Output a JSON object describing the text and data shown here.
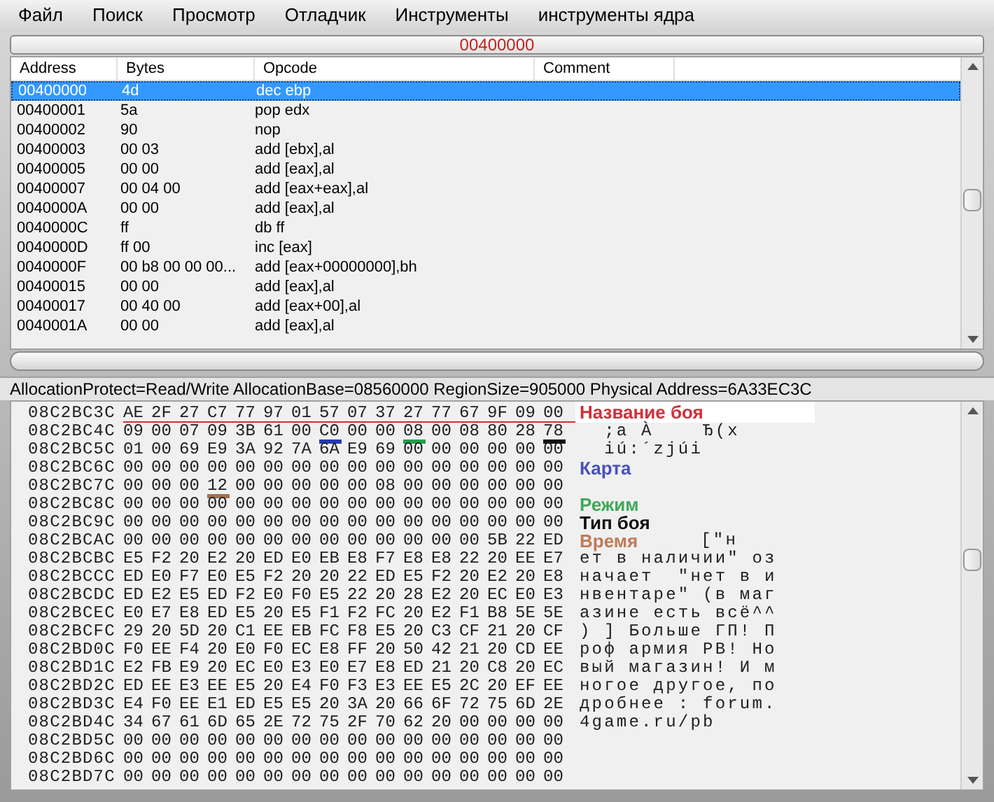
{
  "menu": [
    "Файл",
    "Поиск",
    "Просмотр",
    "Отладчик",
    "Инструменты",
    "инструменты ядра"
  ],
  "address_bar": {
    "value": "00400000"
  },
  "disassembly": {
    "columns": [
      "Address",
      "Bytes",
      "Opcode",
      "Comment"
    ],
    "rows": [
      {
        "address": "00400000",
        "bytes": "4d",
        "opcode": "dec ebp",
        "selected": true
      },
      {
        "address": "00400001",
        "bytes": "5a",
        "opcode": "pop edx",
        "selected": false
      },
      {
        "address": "00400002",
        "bytes": "90",
        "opcode": "nop",
        "selected": false
      },
      {
        "address": "00400003",
        "bytes": "00 03",
        "opcode": "add [ebx],al",
        "selected": false
      },
      {
        "address": "00400005",
        "bytes": "00 00",
        "opcode": "add [eax],al",
        "selected": false
      },
      {
        "address": "00400007",
        "bytes": "00 04 00",
        "opcode": "add [eax+eax],al",
        "selected": false
      },
      {
        "address": "0040000A",
        "bytes": "00 00",
        "opcode": "add [eax],al",
        "selected": false
      },
      {
        "address": "0040000C",
        "bytes": "ff",
        "opcode": "db ff",
        "selected": false
      },
      {
        "address": "0040000D",
        "bytes": "ff 00",
        "opcode": "inc [eax]",
        "selected": false
      },
      {
        "address": "0040000F",
        "bytes": "00 b8 00 00 00...",
        "opcode": "add [eax+00000000],bh",
        "selected": false
      },
      {
        "address": "00400015",
        "bytes": "00 00",
        "opcode": "add [eax],al",
        "selected": false
      },
      {
        "address": "00400017",
        "bytes": "00 40 00",
        "opcode": "add [eax+00],al",
        "selected": false
      },
      {
        "address": "0040001A",
        "bytes": "00 00",
        "opcode": "add [eax],al",
        "selected": false
      }
    ]
  },
  "status": "AllocationProtect=Read/Write  AllocationBase=08560000 RegionSize=905000 Physical Address=6A33EC3C",
  "hex_view": {
    "rows": [
      {
        "address": "08C2BC3C",
        "color": "#d03030",
        "bytes": [
          "AE",
          "2F",
          "27",
          "C7",
          "77",
          "97",
          "01",
          "57",
          "07",
          "37",
          "27",
          "77",
          "67",
          "9F",
          "09",
          "00"
        ],
        "note": {
          "text": "Название боя",
          "color": "#d0303a",
          "boxed": true
        }
      },
      {
        "address": "08C2BC4C",
        "bytes": [
          "09",
          "00",
          "07",
          "09",
          "3B",
          "61",
          "00",
          {
            "text": "C0",
            "color": "#2838b8"
          },
          "00",
          "00",
          {
            "text": "08",
            "color": "#20a050"
          },
          "00",
          "08",
          "80",
          "28",
          {
            "text": "78",
            "color": "#101010"
          }
        ],
        "ascii": "  ;a À    Ђ(x"
      },
      {
        "address": "08C2BC5C",
        "bytes": [
          "01",
          "00",
          "69",
          "E9",
          "3A",
          "92",
          "7A",
          "6A",
          "E9",
          "69",
          "00",
          "00",
          "00",
          "00",
          "00",
          "00"
        ],
        "ascii": "  iú:´zjúi"
      },
      {
        "address": "08C2BC6C",
        "bytes": [
          "00",
          "00",
          "00",
          "00",
          "00",
          "00",
          "00",
          "00",
          "00",
          "00",
          "00",
          "00",
          "00",
          "00",
          "00",
          "00"
        ],
        "note": {
          "text": "Карта",
          "color": "#4a52b4",
          "boxed": false
        }
      },
      {
        "address": "08C2BC7C",
        "bytes": [
          "00",
          "00",
          "00",
          {
            "text": "12",
            "color": "#a07050"
          },
          "00",
          "00",
          "00",
          "00",
          "00",
          "08",
          "00",
          "00",
          "00",
          "00",
          "00",
          "00"
        ]
      },
      {
        "address": "08C2BC8C",
        "bytes": [
          "00",
          "00",
          "00",
          "00",
          "00",
          "00",
          "00",
          "00",
          "00",
          "00",
          "00",
          "00",
          "00",
          "00",
          "00",
          "00"
        ],
        "note": {
          "text": "Режим",
          "color": "#40a858",
          "boxed": false
        }
      },
      {
        "address": "08C2BC9C",
        "bytes": [
          "00",
          "00",
          "00",
          "00",
          "00",
          "00",
          "00",
          "00",
          "00",
          "00",
          "00",
          "00",
          "00",
          "00",
          "00",
          "00"
        ],
        "note": {
          "text": "Тип боя",
          "color": "#101010",
          "boxed": false
        }
      },
      {
        "address": "08C2BCAC",
        "bytes": [
          "00",
          "00",
          "00",
          "00",
          "00",
          "00",
          "00",
          "00",
          "00",
          "00",
          "00",
          "00",
          "00",
          "5B",
          "22",
          "ED"
        ],
        "note": {
          "text": "Время",
          "color": "#c07a58",
          "boxed": false
        },
        "ascii": "[\"н"
      },
      {
        "address": "08C2BCBC",
        "bytes": [
          "E5",
          "F2",
          "20",
          "E2",
          "20",
          "ED",
          "E0",
          "EB",
          "E8",
          "F7",
          "E8",
          "E8",
          "22",
          "20",
          "EE",
          "E7"
        ],
        "ascii": "ет в наличии\" оз"
      },
      {
        "address": "08C2BCCC",
        "bytes": [
          "ED",
          "E0",
          "F7",
          "E0",
          "E5",
          "F2",
          "20",
          "20",
          "22",
          "ED",
          "E5",
          "F2",
          "20",
          "E2",
          "20",
          "E8"
        ],
        "ascii": "начает  \"нет в и"
      },
      {
        "address": "08C2BCDC",
        "bytes": [
          "ED",
          "E2",
          "E5",
          "ED",
          "F2",
          "E0",
          "F0",
          "E5",
          "22",
          "20",
          "28",
          "E2",
          "20",
          "EC",
          "E0",
          "E3"
        ],
        "ascii": "нвентаре\" (в маг"
      },
      {
        "address": "08C2BCEC",
        "bytes": [
          "E0",
          "E7",
          "E8",
          "ED",
          "E5",
          "20",
          "E5",
          "F1",
          "F2",
          "FC",
          "20",
          "E2",
          "F1",
          "B8",
          "5E",
          "5E"
        ],
        "ascii": "азине есть всё^^"
      },
      {
        "address": "08C2BCFC",
        "bytes": [
          "29",
          "20",
          "5D",
          "20",
          "C1",
          "EE",
          "EB",
          "FC",
          "F8",
          "E5",
          "20",
          "C3",
          "CF",
          "21",
          "20",
          "CF"
        ],
        "ascii": ") ] Больше ГП! П"
      },
      {
        "address": "08C2BD0C",
        "bytes": [
          "F0",
          "EE",
          "F4",
          "20",
          "E0",
          "F0",
          "EC",
          "E8",
          "FF",
          "20",
          "50",
          "42",
          "21",
          "20",
          "CD",
          "EE"
        ],
        "ascii": "роф армия PB! Но"
      },
      {
        "address": "08C2BD1C",
        "bytes": [
          "E2",
          "FB",
          "E9",
          "20",
          "EC",
          "E0",
          "E3",
          "E0",
          "E7",
          "E8",
          "ED",
          "21",
          "20",
          "C8",
          "20",
          "EC"
        ],
        "ascii": "вый магазин! И м"
      },
      {
        "address": "08C2BD2C",
        "bytes": [
          "ED",
          "EE",
          "E3",
          "EE",
          "E5",
          "20",
          "E4",
          "F0",
          "F3",
          "E3",
          "EE",
          "E5",
          "2C",
          "20",
          "EF",
          "EE"
        ],
        "ascii": "ногое другое, по"
      },
      {
        "address": "08C2BD3C",
        "bytes": [
          "E4",
          "F0",
          "EE",
          "E1",
          "ED",
          "E5",
          "E5",
          "20",
          "3A",
          "20",
          "66",
          "6F",
          "72",
          "75",
          "6D",
          "2E"
        ],
        "ascii": "дробнее : forum."
      },
      {
        "address": "08C2BD4C",
        "bytes": [
          "34",
          "67",
          "61",
          "6D",
          "65",
          "2E",
          "72",
          "75",
          "2F",
          "70",
          "62",
          "20",
          "00",
          "00",
          "00",
          "00"
        ],
        "ascii": "4game.ru/pb"
      },
      {
        "address": "08C2BD5C",
        "bytes": [
          "00",
          "00",
          "00",
          "00",
          "00",
          "00",
          "00",
          "00",
          "00",
          "00",
          "00",
          "00",
          "00",
          "00",
          "00",
          "00"
        ]
      },
      {
        "address": "08C2BD6C",
        "bytes": [
          "00",
          "00",
          "00",
          "00",
          "00",
          "00",
          "00",
          "00",
          "00",
          "00",
          "00",
          "00",
          "00",
          "00",
          "00",
          "00"
        ]
      },
      {
        "address": "08C2BD7C",
        "bytes": [
          "00",
          "00",
          "00",
          "00",
          "00",
          "00",
          "00",
          "00",
          "00",
          "00",
          "00",
          "00",
          "00",
          "00",
          "00",
          "00"
        ]
      }
    ]
  }
}
